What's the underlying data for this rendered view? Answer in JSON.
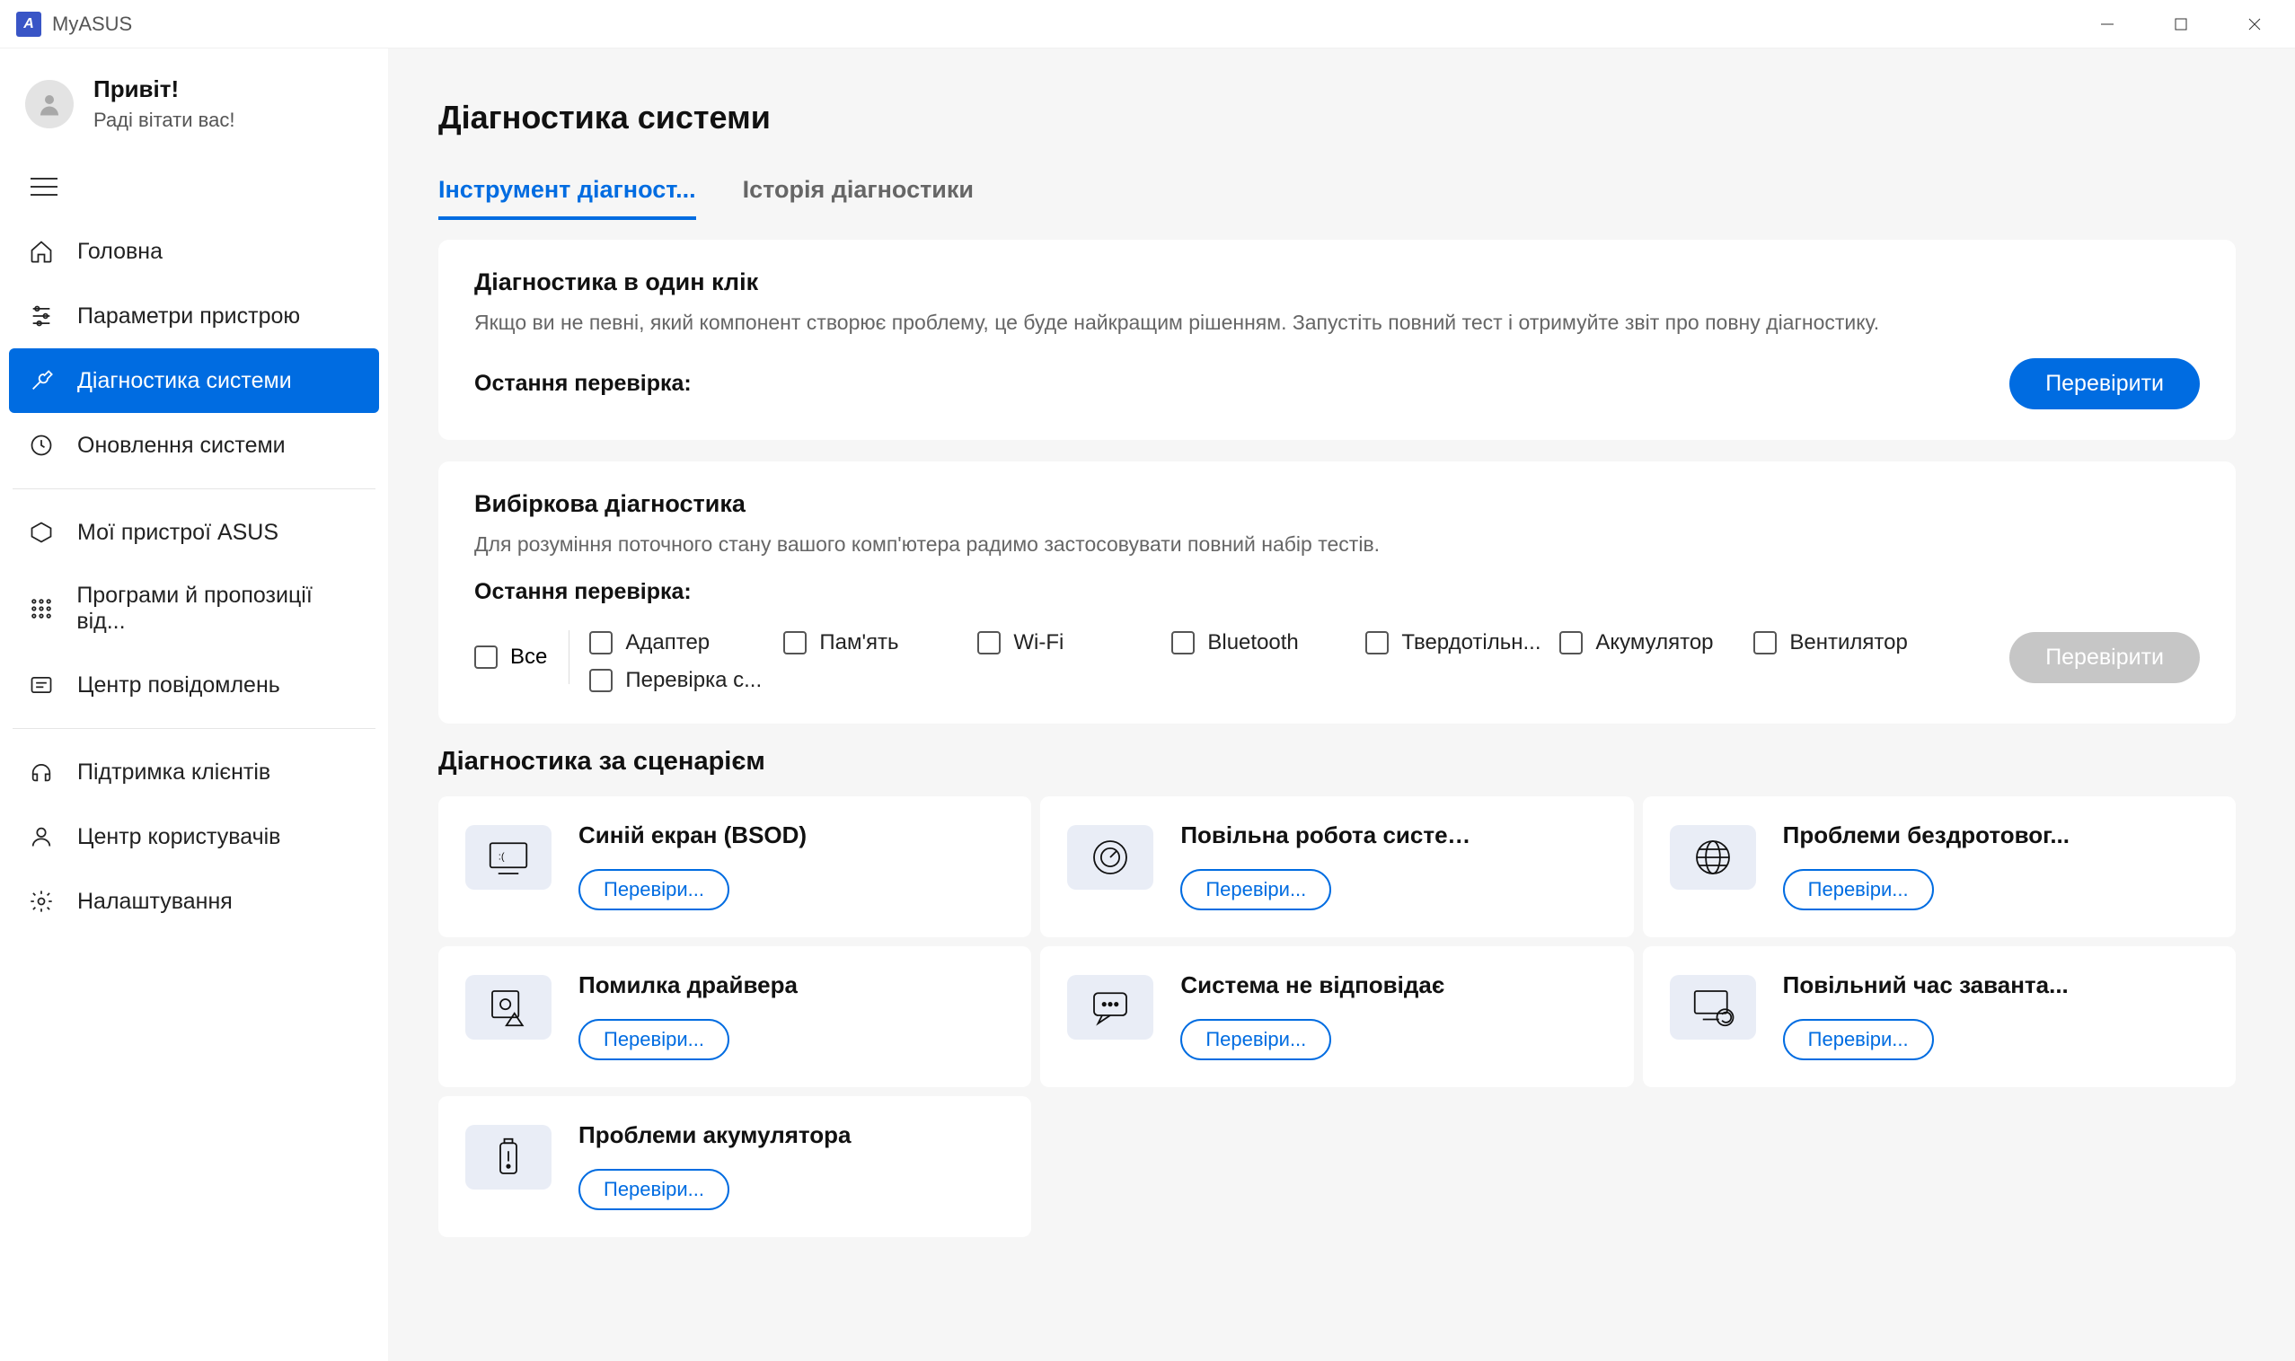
{
  "window": {
    "title": "MyASUS"
  },
  "user": {
    "hello": "Привіт!",
    "welcome": "Раді вітати вас!"
  },
  "sidebar": {
    "items": [
      {
        "label": "Головна"
      },
      {
        "label": "Параметри пристрою"
      },
      {
        "label": "Діагностика системи"
      },
      {
        "label": "Оновлення системи"
      },
      {
        "label": "Мої пристрої ASUS"
      },
      {
        "label": "Програми й пропозиції від..."
      },
      {
        "label": "Центр повідомлень"
      },
      {
        "label": "Підтримка клієнтів"
      },
      {
        "label": "Центр користувачів"
      },
      {
        "label": "Налаштування"
      }
    ]
  },
  "page": {
    "title": "Діагностика системи"
  },
  "tabs": [
    {
      "label": "Інструмент діагност..."
    },
    {
      "label": "Історія діагностики"
    }
  ],
  "oneclick": {
    "title": "Діагностика в один клік",
    "sub": "Якщо ви не певні, який компонент створює проблему, це буде найкращим рішенням. Запустіть повний тест і отримуйте звіт про повну діагностику.",
    "last_label": "Остання перевірка:",
    "button": "Перевірити"
  },
  "custom": {
    "title": "Вибіркова діагностика",
    "sub": "Для розуміння поточного стану вашого комп'ютера радимо застосовувати повний набір тестів.",
    "last_label": "Остання перевірка:",
    "all_label": "Все",
    "checks": [
      "Адаптер",
      "Пам'ять",
      "Wi-Fi",
      "Bluetooth",
      "Твердотільн...",
      "Акумулятор",
      "Вентилятор",
      "Перевірка с..."
    ],
    "button": "Перевірити"
  },
  "scenario_section_title": "Діагностика за сценарієм",
  "scenarios": [
    {
      "title": "Синій екран (BSOD)",
      "button": "Перевіри..."
    },
    {
      "title": "Повільна робота системи",
      "button": "Перевіри..."
    },
    {
      "title": "Проблеми бездротовог...",
      "button": "Перевіри..."
    },
    {
      "title": "Помилка драйвера",
      "button": "Перевіри..."
    },
    {
      "title": "Система не відповідає",
      "button": "Перевіри..."
    },
    {
      "title": "Повільний час заванта...",
      "button": "Перевіри..."
    },
    {
      "title": "Проблеми акумулятора",
      "button": "Перевіри..."
    }
  ]
}
